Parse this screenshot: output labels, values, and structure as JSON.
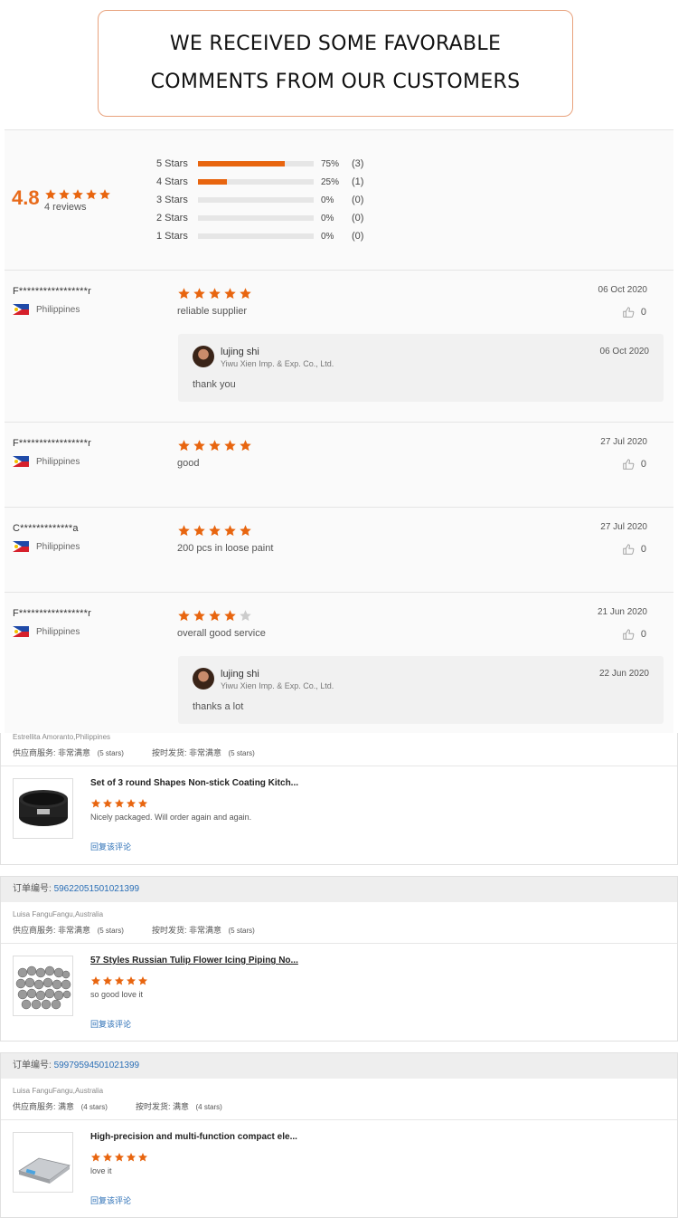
{
  "banner": {
    "line1": "WE RECEIVED SOME FAVORABLE",
    "line2": "COMMENTS FROM OUR CUSTOMERS"
  },
  "summary": {
    "rating": "4.8",
    "rating_value": 4.8,
    "reviews_label": "4 reviews",
    "distribution": [
      {
        "label": "5 Stars",
        "percent_label": "75%",
        "count_label": "(3)",
        "fraction": 0.75
      },
      {
        "label": "4 Stars",
        "percent_label": "25%",
        "count_label": "(1)",
        "fraction": 0.25
      },
      {
        "label": "3 Stars",
        "percent_label": "0%",
        "count_label": "(0)",
        "fraction": 0
      },
      {
        "label": "2 Stars",
        "percent_label": "0%",
        "count_label": "(0)",
        "fraction": 0
      },
      {
        "label": "1 Stars",
        "percent_label": "0%",
        "count_label": "(0)",
        "fraction": 0
      }
    ]
  },
  "reviews": [
    {
      "name": "F*****************r",
      "country": "Philippines",
      "stars": 5,
      "text": "reliable supplier",
      "date": "06 Oct 2020",
      "likes": "0",
      "reply": {
        "name": "lujing shi",
        "company": "Yiwu Xien Imp. & Exp. Co., Ltd.",
        "date": "06 Oct 2020",
        "text": "thank you"
      }
    },
    {
      "name": "F*****************r",
      "country": "Philippines",
      "stars": 5,
      "text": "good",
      "date": "27 Jul 2020",
      "likes": "0"
    },
    {
      "name": "C*************a",
      "country": "Philippines",
      "stars": 5,
      "text": "200 pcs in loose paint",
      "date": "27 Jul 2020",
      "likes": "0"
    },
    {
      "name": "F*****************r",
      "country": "Philippines",
      "stars": 4,
      "text": "overall good service",
      "date": "21 Jun 2020",
      "likes": "0",
      "reply": {
        "name": "lujing shi",
        "company": "Yiwu Xien Imp. & Exp. Co., Ltd.",
        "date": "22 Jun 2020",
        "text": "thanks a lot"
      }
    }
  ],
  "orders": [
    {
      "order_label": "",
      "order_number": "",
      "buyer": "Estrellita Amoranto,Philippines",
      "service_label": "供应商服务:",
      "service_value": "非常满意",
      "service_stars": "(5 stars)",
      "delivery_label": "按时发货:",
      "delivery_value": "非常满意",
      "delivery_stars": "(5 stars)",
      "product_title": "Set of 3 round Shapes Non-stick Coating Kitch...",
      "product_stars": 5,
      "comment": "Nicely packaged. Will order again and again.",
      "reply_link": "回复该评论"
    },
    {
      "order_label": "订单编号:",
      "order_number": "59622051501021399",
      "buyer": "Luisa FanguFangu,Australia",
      "service_label": "供应商服务:",
      "service_value": "非常满意",
      "service_stars": "(5 stars)",
      "delivery_label": "按时发货:",
      "delivery_value": "非常满意",
      "delivery_stars": "(5 stars)",
      "product_title": "57 Styles Russian Tulip Flower Icing Piping No...",
      "product_stars": 5,
      "comment": "so good love it",
      "reply_link": "回复该评论"
    },
    {
      "order_label": "订单编号:",
      "order_number": "59979594501021399",
      "buyer": "Luisa FanguFangu,Australia",
      "service_label": "供应商服务:",
      "service_value": "满意",
      "service_stars": "(4 stars)",
      "delivery_label": "按时发货:",
      "delivery_value": "满意",
      "delivery_stars": "(4 stars)",
      "product_title": "High-precision and multi-function compact ele...",
      "product_stars": 5,
      "comment": "love it",
      "reply_link": "回复该评论"
    }
  ],
  "colors": {
    "accent": "#e8650f",
    "star_empty": "#cccccc",
    "link": "#2b6fb6"
  }
}
